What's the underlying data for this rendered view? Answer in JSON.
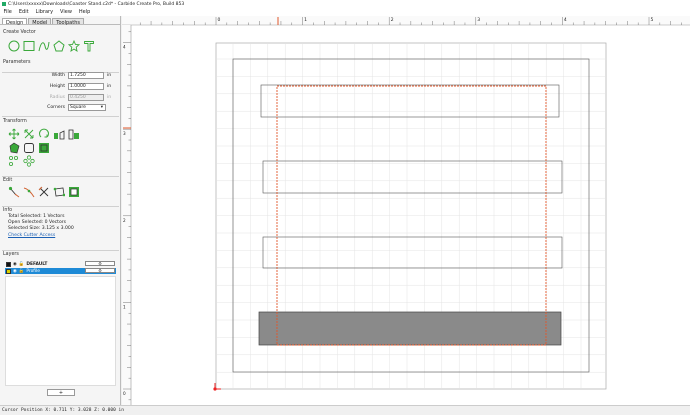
{
  "titlebar": {
    "title": "C:\\Users\\xxxxx\\Downloads\\Coaster Stand.c2d* - Carbide Create Pro, Build 853"
  },
  "menu": [
    "File",
    "Edit",
    "Library",
    "View",
    "Help"
  ],
  "tabs": [
    "Design",
    "Model",
    "Toolpaths"
  ],
  "create_vector": {
    "title": "Create Vector",
    "icons": [
      "circle-tool-icon",
      "rectangle-tool-icon",
      "curve-tool-icon",
      "polygon-tool-icon",
      "star-tool-icon",
      "text-tool-icon"
    ]
  },
  "parameters": {
    "title": "Parameters",
    "width_label": "Width",
    "width_value": "1.7250",
    "width_unit": "in",
    "height_label": "Height",
    "height_value": "1.0000",
    "height_unit": "in",
    "radius_label": "Radius",
    "radius_value": "0.4250",
    "radius_unit": "in",
    "corners_label": "Corners",
    "corners_value": "Square"
  },
  "transform": {
    "title": "Transform"
  },
  "edit": {
    "title": "Edit"
  },
  "info": {
    "title": "Info",
    "total_selected": "Total Selected:   1 Vectors",
    "open_selected": "Open Selected:   0 Vectors",
    "selected_size": "Selected Size:     3.125 x 3.000",
    "check_cutter": "Check Cutter Access"
  },
  "layers": {
    "title": "Layers",
    "rows": [
      {
        "name": "DEFAULT",
        "color": "#111111",
        "selected": false
      },
      {
        "name": "Profile",
        "color": "#d8d000",
        "selected": true
      }
    ],
    "add_label": "+"
  },
  "ruler": {
    "top_labels": [
      "0",
      "1",
      "2",
      "3",
      "4",
      "5"
    ],
    "side_labels": [
      "4",
      "3",
      "2",
      "1",
      "0"
    ]
  },
  "status": {
    "text": "Cursor Position X: 0.711 Y: 3.028 Z: 0.000 in"
  },
  "colors": {
    "accent": "#1e8ad6",
    "toolpath": "#e0572b",
    "green_icon": "#3aa83a"
  }
}
